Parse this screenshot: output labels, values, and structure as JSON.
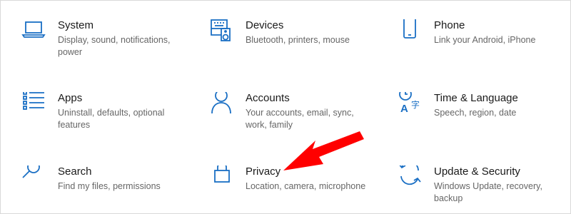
{
  "accent_color": "#1a6fc4",
  "annotation_color": "#ff0000",
  "tiles": [
    {
      "icon": "laptop-icon",
      "title": "System",
      "description": "Display, sound, notifications, power"
    },
    {
      "icon": "devices-icon",
      "title": "Devices",
      "description": "Bluetooth, printers, mouse"
    },
    {
      "icon": "phone-icon",
      "title": "Phone",
      "description": "Link your Android, iPhone"
    },
    {
      "icon": "apps-list-icon",
      "title": "Apps",
      "description": "Uninstall, defaults, optional features"
    },
    {
      "icon": "person-icon",
      "title": "Accounts",
      "description": "Your accounts, email, sync, work, family"
    },
    {
      "icon": "time-language-icon",
      "title": "Time & Language",
      "description": "Speech, region, date"
    },
    {
      "icon": "search-icon",
      "title": "Search",
      "description": "Find my files, permissions"
    },
    {
      "icon": "lock-icon",
      "title": "Privacy",
      "description": "Location, camera, microphone"
    },
    {
      "icon": "sync-icon",
      "title": "Update & Security",
      "description": "Windows Update, recovery, backup"
    }
  ]
}
